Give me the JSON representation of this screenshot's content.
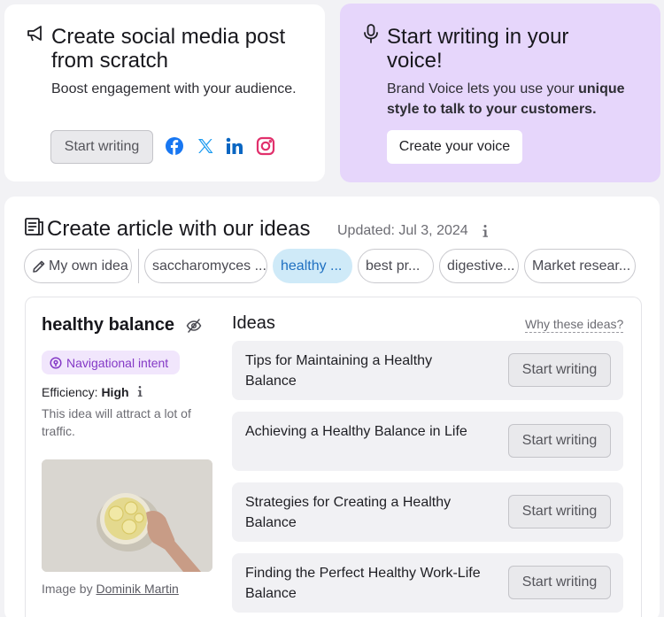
{
  "social_card": {
    "title": "Create social media post from scratch",
    "subtitle": "Boost engagement with your audience.",
    "button": "Start writing",
    "icons": [
      "megaphone-icon",
      "facebook-icon",
      "x-icon",
      "linkedin-icon",
      "instagram-icon"
    ],
    "colors": {
      "facebook": "#1877f2",
      "x": "#1d9bf0",
      "linkedin": "#0a66c2",
      "instagram": "#e1306c"
    }
  },
  "voice_card": {
    "title": "Start writing in your voice!",
    "subtitle_plain": "Brand Voice lets you use your ",
    "subtitle_bold": "unique style to talk to your customers.",
    "button": "Create your voice",
    "icon": "microphone-icon",
    "background": "#e6d6fb"
  },
  "ideas_panel": {
    "title": "Create article with our ideas",
    "updated": "Updated: Jul 3, 2024",
    "chips": [
      {
        "label": "My own idea",
        "icon": "pencil-icon"
      },
      {
        "label": "saccharomyces ..."
      },
      {
        "label": "healthy ...",
        "active": true
      },
      {
        "label": "best pr..."
      },
      {
        "label": "digestive..."
      },
      {
        "label": "Market resear..."
      }
    ],
    "selected_idea": {
      "title": "healthy balance",
      "intent": "Navigational intent",
      "efficiency_label": "Efficiency: ",
      "efficiency_value": "High",
      "description": "This idea will attract a lot of traffic.",
      "credit_prefix": "Image by ",
      "credit_author": "Dominik Martin"
    },
    "ideas_heading": "Ideas",
    "why_link": "Why these ideas?",
    "ideas": [
      {
        "text": "Tips for Maintaining a Healthy Balance",
        "button": "Start writing"
      },
      {
        "text": "Achieving a Healthy Balance in Life",
        "button": "Start writing"
      },
      {
        "text": "Strategies for Creating a Healthy Balance",
        "button": "Start writing"
      },
      {
        "text": "Finding the Perfect Healthy Work-Life Balance",
        "button": "Start writing"
      }
    ]
  }
}
